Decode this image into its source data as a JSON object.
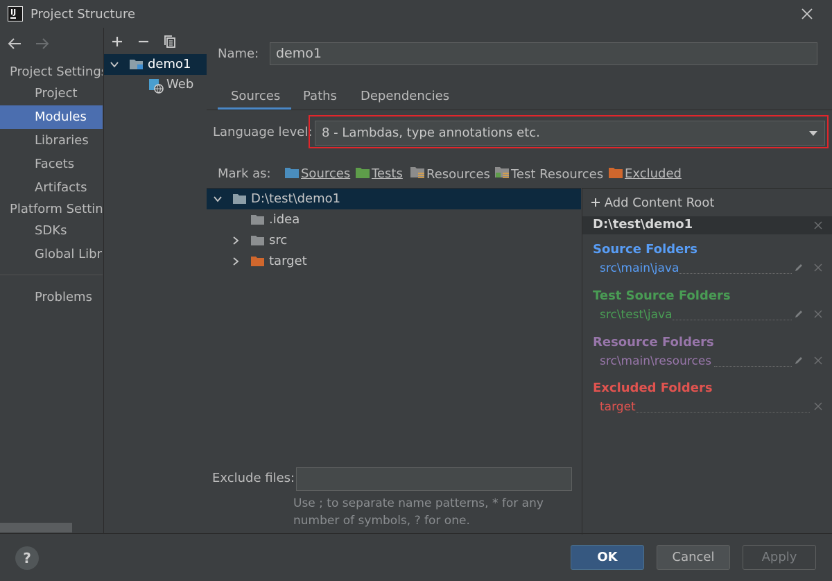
{
  "window": {
    "title": "Project Structure",
    "logo_text": "IJ"
  },
  "sidebar": {
    "project_settings_heading": "Project Settings",
    "project_items": [
      "Project",
      "Modules",
      "Libraries",
      "Facets",
      "Artifacts"
    ],
    "platform_settings_heading": "Platform Settings",
    "platform_items": [
      "SDKs",
      "Global Libraries"
    ],
    "problems": "Problems",
    "selected": "Modules"
  },
  "module_tree": {
    "module": "demo1",
    "facet": "Web"
  },
  "module": {
    "name_label": "Name:",
    "name_value": "demo1",
    "tabs": [
      "Sources",
      "Paths",
      "Dependencies"
    ],
    "active_tab": "Sources",
    "language_level_label": "Language level:",
    "language_level_value": "8 - Lambdas, type annotations etc.",
    "mark_as_label": "Mark as:",
    "mark_as": [
      {
        "label": "Sources",
        "color": "#4a8dbd"
      },
      {
        "label": "Tests",
        "color": "#5e9d4a"
      },
      {
        "label": "Resources",
        "color": "#8c8c8c"
      },
      {
        "label": "Test Resources",
        "color": "#8c8c8c"
      },
      {
        "label": "Excluded",
        "color": "#d0672d"
      }
    ]
  },
  "file_tree": {
    "root": "D:\\test\\demo1",
    "children": [
      ".idea",
      "src",
      "target"
    ]
  },
  "content_root": {
    "add_label": "Add Content Root",
    "path": "D:\\test\\demo1",
    "sections": [
      {
        "title": "Source Folders",
        "path": "src\\main\\java",
        "color": "#589df6"
      },
      {
        "title": "Test Source Folders",
        "path": "src\\test\\java",
        "color": "#499c54"
      },
      {
        "title": "Resource Folders",
        "path": "src\\main\\resources",
        "color": "#9876aa"
      },
      {
        "title": "Excluded Folders",
        "path": "target",
        "color": "#e0534f"
      }
    ]
  },
  "exclude": {
    "label": "Exclude files:",
    "value": "",
    "hint_line1": "Use ; to separate name patterns, * for any",
    "hint_line2": "number of symbols, ? for one."
  },
  "buttons": {
    "help": "?",
    "ok": "OK",
    "cancel": "Cancel",
    "apply": "Apply"
  },
  "colors": {
    "accent": "#4b6eaf",
    "highlight_box": "#e0262b",
    "selection": "#0d293e"
  }
}
